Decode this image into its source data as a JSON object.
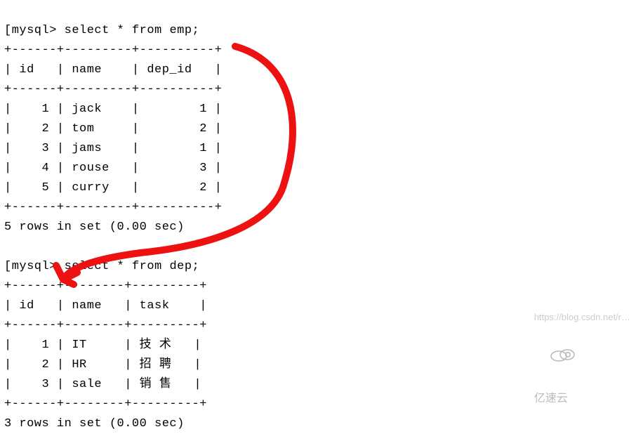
{
  "prompt": "mysql> ",
  "queries": {
    "emp_query": "select * from emp;",
    "dep_query": "select * from dep;"
  },
  "emp": {
    "columns": [
      "id",
      "name",
      "dep_id"
    ],
    "rows": [
      {
        "id": 1,
        "name": "jack",
        "dep_id": 1
      },
      {
        "id": 2,
        "name": "tom",
        "dep_id": 2
      },
      {
        "id": 3,
        "name": "jams",
        "dep_id": 1
      },
      {
        "id": 4,
        "name": "rouse",
        "dep_id": 3
      },
      {
        "id": 5,
        "name": "curry",
        "dep_id": 2
      }
    ],
    "footer": "5 rows in set (0.00 sec)"
  },
  "dep": {
    "columns": [
      "id",
      "name",
      "task"
    ],
    "rows": [
      {
        "id": 1,
        "name": "IT",
        "task": "技 术"
      },
      {
        "id": 2,
        "name": "HR",
        "task": "招 聘"
      },
      {
        "id": 3,
        "name": "sale",
        "task": "销 售"
      }
    ],
    "footer": "3 rows in set (0.00 sec)"
  },
  "watermark": {
    "text": "https://blog.csdn.net/r…",
    "brand": "亿速云"
  },
  "annotation": {
    "color": "#e11",
    "description": "hand-drawn-arrow linking emp.dep_id column to dep.id column"
  }
}
